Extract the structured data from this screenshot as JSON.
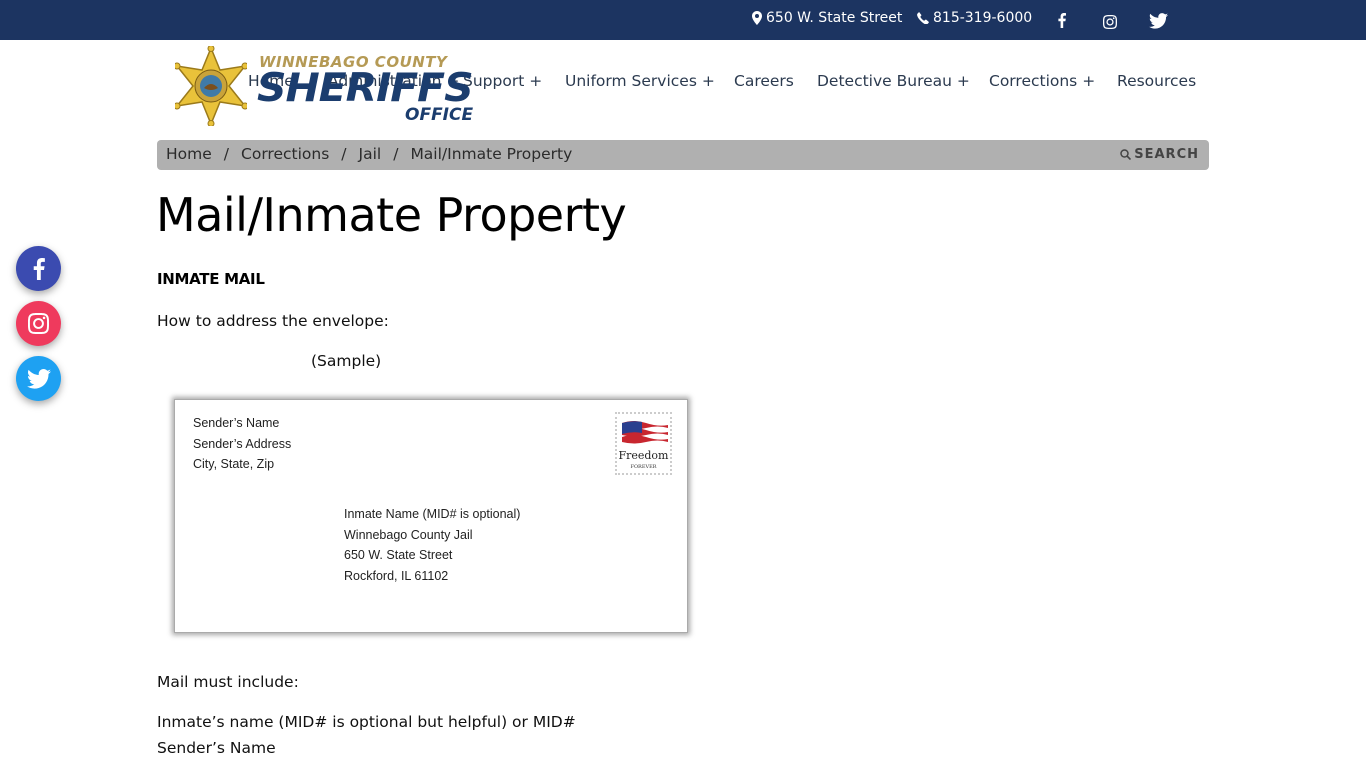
{
  "topbar": {
    "address": "650 W. State Street",
    "phone": "815-319-6000",
    "icons": [
      "map-marker-icon",
      "phone-icon",
      "facebook-icon",
      "instagram-icon",
      "twitter-icon"
    ],
    "background": "#1c3461"
  },
  "logo": {
    "line1": "WINNEBAGO COUNTY",
    "line2": "SHERIFFS",
    "line3": "OFFICE"
  },
  "nav": {
    "items": [
      {
        "label": "Home"
      },
      {
        "label": "Administration +"
      },
      {
        "label": "Support +"
      },
      {
        "label": "Uniform Services +"
      },
      {
        "label": "Careers"
      },
      {
        "label": "Detective Bureau +"
      },
      {
        "label": "Corrections +"
      },
      {
        "label": "Resources"
      }
    ]
  },
  "breadcrumb": {
    "items": [
      "Home",
      "Corrections",
      "Jail",
      "Mail/Inmate Property"
    ],
    "separator": "/",
    "search_label": "SEARCH"
  },
  "page": {
    "title": "Mail/Inmate Property",
    "section_heading": "INMATE MAIL",
    "how_to": "How to address the envelope:",
    "sample": "(Sample)",
    "must_include": "Mail must include:",
    "include_items": [
      "Inmate’s name (MID# is optional but helpful) or MID#",
      "Sender’s Name"
    ]
  },
  "envelope": {
    "sender": [
      "Sender’s Name",
      "Sender’s Address",
      "City, State, Zip"
    ],
    "recipient": [
      "Inmate Name (MID# is optional)",
      "Winnebago County Jail",
      "650 W. State Street",
      "Rockford, IL  61102"
    ],
    "stamp_text": "Freedom",
    "stamp_subtext": "FOREVER"
  },
  "floating_social": {
    "items": [
      {
        "name": "facebook",
        "color": "#3b4bb0"
      },
      {
        "name": "instagram",
        "color": "#ef3a5d"
      },
      {
        "name": "twitter",
        "color": "#1ea1f2"
      }
    ]
  }
}
